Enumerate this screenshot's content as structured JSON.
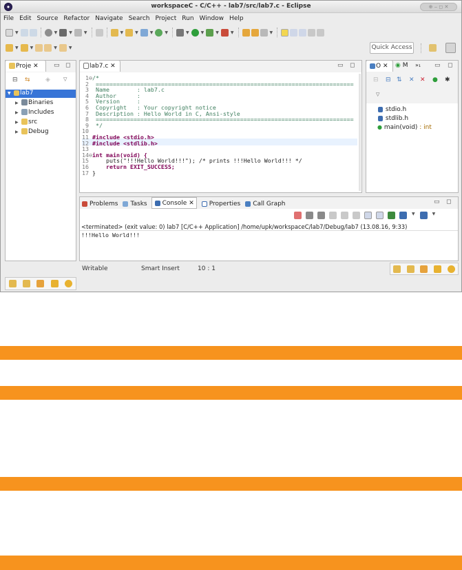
{
  "window": {
    "title": "workspaceC - C/C++ - lab7/src/lab7.c - Eclipse",
    "controls": "⊕ ‒ ◻ ✕"
  },
  "menu": [
    "File",
    "Edit",
    "Source",
    "Refactor",
    "Navigate",
    "Search",
    "Project",
    "Run",
    "Window",
    "Help"
  ],
  "quick_access": "Quick Access",
  "project_explorer": {
    "tab": "Proje ✕",
    "items": [
      {
        "label": "lab7",
        "level": 0,
        "selected": true
      },
      {
        "label": "Binaries",
        "level": 1
      },
      {
        "label": "Includes",
        "level": 1
      },
      {
        "label": "src",
        "level": 1
      },
      {
        "label": "Debug",
        "level": 1
      }
    ]
  },
  "editor": {
    "tab": "lab7.c ✕",
    "lines": [
      {
        "n": "1",
        "html": "/*"
      },
      {
        "n": "2",
        "html": " ==========================================================================="
      },
      {
        "n": "3",
        "html": " Name        : lab7.c"
      },
      {
        "n": "4",
        "html": " Author      :"
      },
      {
        "n": "5",
        "html": " Version     :"
      },
      {
        "n": "6",
        "html": " Copyright   : Your copyright notice"
      },
      {
        "n": "7",
        "html": " Description : Hello World in C, Ansi-style"
      },
      {
        "n": "8",
        "html": " ==========================================================================="
      },
      {
        "n": "9",
        "html": " */"
      },
      {
        "n": "10",
        "html": ""
      },
      {
        "n": "11",
        "html": "#include <stdio.h>"
      },
      {
        "n": "12",
        "html": "#include <stdlib.h>"
      },
      {
        "n": "13",
        "html": ""
      },
      {
        "n": "14",
        "html": "int main(void) {"
      },
      {
        "n": "15",
        "html": "\tputs(\"!!!Hello World!!!\"); /* prints !!!Hello World!!! */"
      },
      {
        "n": "16",
        "html": "\treturn EXIT_SUCCESS;"
      },
      {
        "n": "17",
        "html": "}"
      }
    ]
  },
  "outline": {
    "tab1": "O ✕",
    "tab2": "M",
    "tab3": "»₁",
    "items": [
      {
        "label": "stdio.h"
      },
      {
        "label": "stdlib.h"
      },
      {
        "label": "main(void)",
        "suffix": " : int"
      }
    ]
  },
  "console": {
    "tabs": [
      "Problems",
      "Tasks",
      "Console ✕",
      "Properties",
      "Call Graph"
    ],
    "header": "<terminated> (exit value: 0) lab7 [C/C++ Application] /home/upk/workspaceC/lab7/Debug/lab7 (13.08.16, 9:33)",
    "output": "!!!Hello World!!!"
  },
  "statusbar": {
    "writable": "Writable",
    "mode": "Smart Insert",
    "position": "10 : 1"
  },
  "colors": {
    "accent": "#f7931e",
    "selection": "#3875d7"
  }
}
